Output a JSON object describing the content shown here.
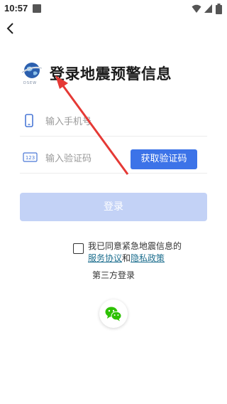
{
  "status_bar": {
    "time": "10:57"
  },
  "brand": {
    "title": "登录地震预警信息",
    "logo_caption": "DSEW"
  },
  "phone_field": {
    "placeholder": "输入手机号",
    "value": ""
  },
  "code_field": {
    "placeholder": "输入验证码",
    "value": "",
    "icon_text": "123"
  },
  "get_code_button": {
    "label": "获取验证码"
  },
  "login_button": {
    "label": "登录"
  },
  "agreement": {
    "prefix": "我已同意紧急地震信息的",
    "service_link": "服务协议",
    "conjunction": "和",
    "privacy_link": "隐私政策",
    "checked": false
  },
  "third_party": {
    "label": "第三方登录",
    "providers": [
      "wechat-icon"
    ]
  },
  "colors": {
    "accent": "#3c73e8",
    "login_disabled": "#c3d2f6",
    "link": "#1e6f8f",
    "wechat": "#2dc100",
    "annotation_arrow": "#e53935"
  }
}
